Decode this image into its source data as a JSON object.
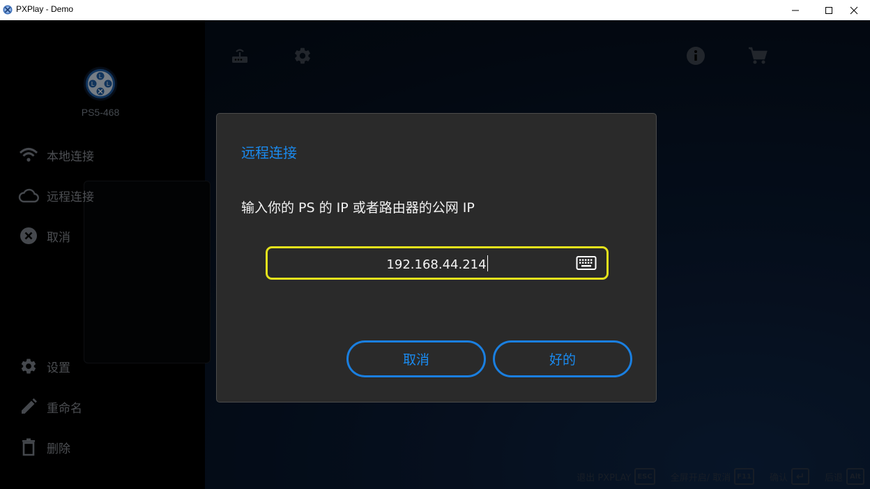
{
  "window": {
    "title": "PXPlay - Demo"
  },
  "sidebar": {
    "device_name": "PS5-468",
    "items": [
      {
        "label": "本地连接",
        "icon": "wifi-icon"
      },
      {
        "label": "远程连接",
        "icon": "cloud-icon"
      },
      {
        "label": "取消",
        "icon": "close-circle-icon"
      },
      {
        "label": "设置",
        "icon": "gear-icon"
      },
      {
        "label": "重命名",
        "icon": "pencil-icon"
      },
      {
        "label": "删除",
        "icon": "trash-icon"
      }
    ]
  },
  "toolbar": {
    "icons": [
      "help-icon",
      "reddit-icon",
      "router-icon",
      "settings-icon",
      "info-icon",
      "cart-icon"
    ]
  },
  "dialog": {
    "title": "远程连接",
    "message": "输入你的 PS 的 IP 或者路由器的公网 IP",
    "ip_value": "192.168.44.214",
    "cancel_label": "取消",
    "ok_label": "好的"
  },
  "hints": [
    {
      "label": "退出 PXPLAY",
      "key": "ESC"
    },
    {
      "label": "全屏开启/ 取消",
      "key": "F11"
    },
    {
      "label": "确认",
      "key": "↵"
    },
    {
      "label": "后退",
      "key": "Alt"
    }
  ],
  "colors": {
    "accent": "#1a8bf0",
    "focus_border": "#e4e21c",
    "dialog_bg": "#2a2a2a"
  }
}
